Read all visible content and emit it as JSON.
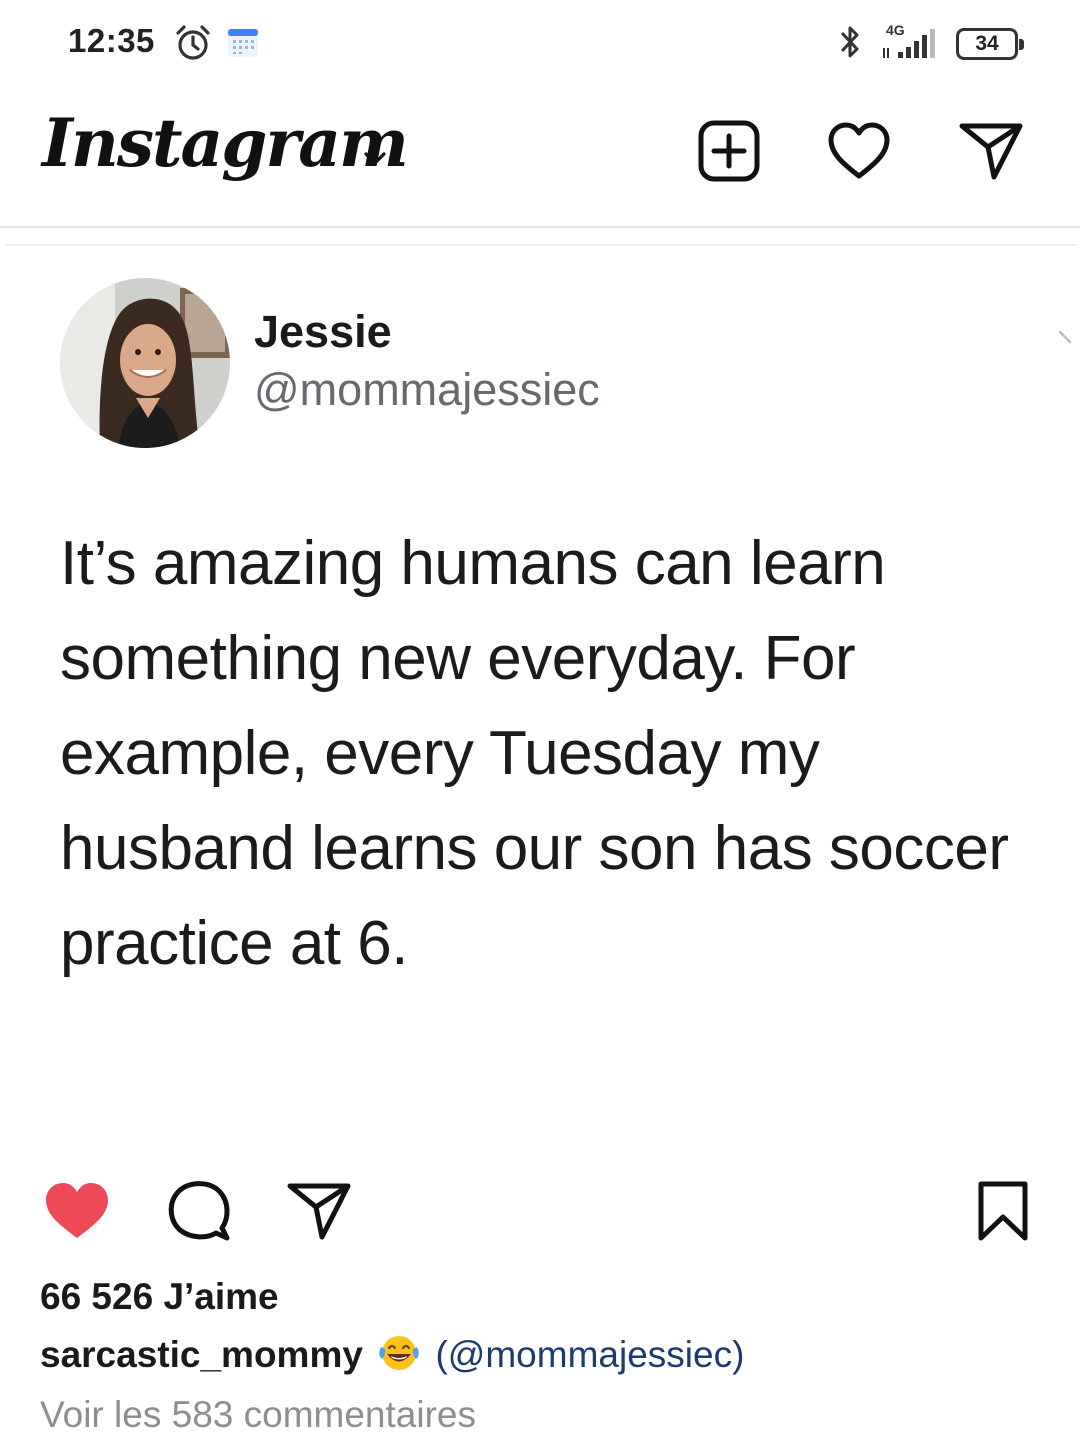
{
  "status_bar": {
    "time": "12:35",
    "network_label": "4G",
    "battery_level": "34"
  },
  "header": {
    "app_name": "Instagram"
  },
  "tweet": {
    "name": "Jessie",
    "handle": "@mommajessiec",
    "text": "It’s amazing humans can learn something new everyday. For example, every Tuesday my husband learns our son has soccer practice at 6."
  },
  "post": {
    "liked": true,
    "likes_label": "66 526 J’aime",
    "caption_user": "sarcastic_mommy",
    "caption_emoji": "laughing-tears-emoji",
    "caption_mention": "(@mommajessiec)",
    "comments_link": "Voir les 583 commentaires"
  },
  "colors": {
    "like_red": "#ed4956",
    "text_dark": "#111111",
    "muted_gray": "#8e8e8e",
    "mention_blue": "#1c3b6e"
  }
}
